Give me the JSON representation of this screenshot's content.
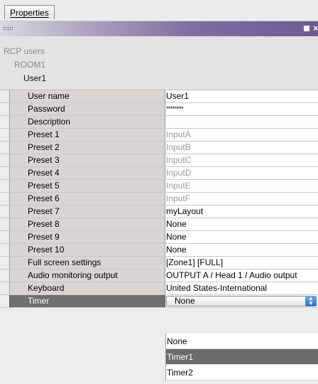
{
  "tab": {
    "label": "Properties"
  },
  "titlebar": {
    "grip_icon": "grip-dots-icon",
    "max_icon": "square-icon",
    "close_icon": "close-icon",
    "close_glyph": "×"
  },
  "tree": {
    "root": "RCP users",
    "group": "ROOM1",
    "user": "User1"
  },
  "properties": [
    {
      "label": "User name",
      "value": "User1"
    },
    {
      "label": "Password",
      "value": "********"
    },
    {
      "label": "Description",
      "value": ""
    },
    {
      "label": "Preset 1",
      "value": "InputA"
    },
    {
      "label": "Preset 2",
      "value": "InputB"
    },
    {
      "label": "Preset 3",
      "value": "InputC"
    },
    {
      "label": "Preset 4",
      "value": "InputD"
    },
    {
      "label": "Preset 5",
      "value": "InputE"
    },
    {
      "label": "Preset 6",
      "value": "InputF"
    },
    {
      "label": "Preset 7",
      "value": "myLayout"
    },
    {
      "label": "Preset 8",
      "value": "None"
    },
    {
      "label": "Preset 9",
      "value": "None"
    },
    {
      "label": "Preset 10",
      "value": "None"
    },
    {
      "label": "Full screen settings",
      "value": "[Zone1] [FULL]"
    },
    {
      "label": "Audio monitoring output",
      "value": "OUTPUT A / Head 1 / Audio output"
    },
    {
      "label": "Keyboard",
      "value": "United States-International"
    },
    {
      "label": "Timer",
      "value": "None"
    }
  ],
  "timer_dropdown": {
    "selected": "None",
    "options": [
      "None",
      "Timer1",
      "Timer2"
    ],
    "highlighted": "Timer1"
  }
}
